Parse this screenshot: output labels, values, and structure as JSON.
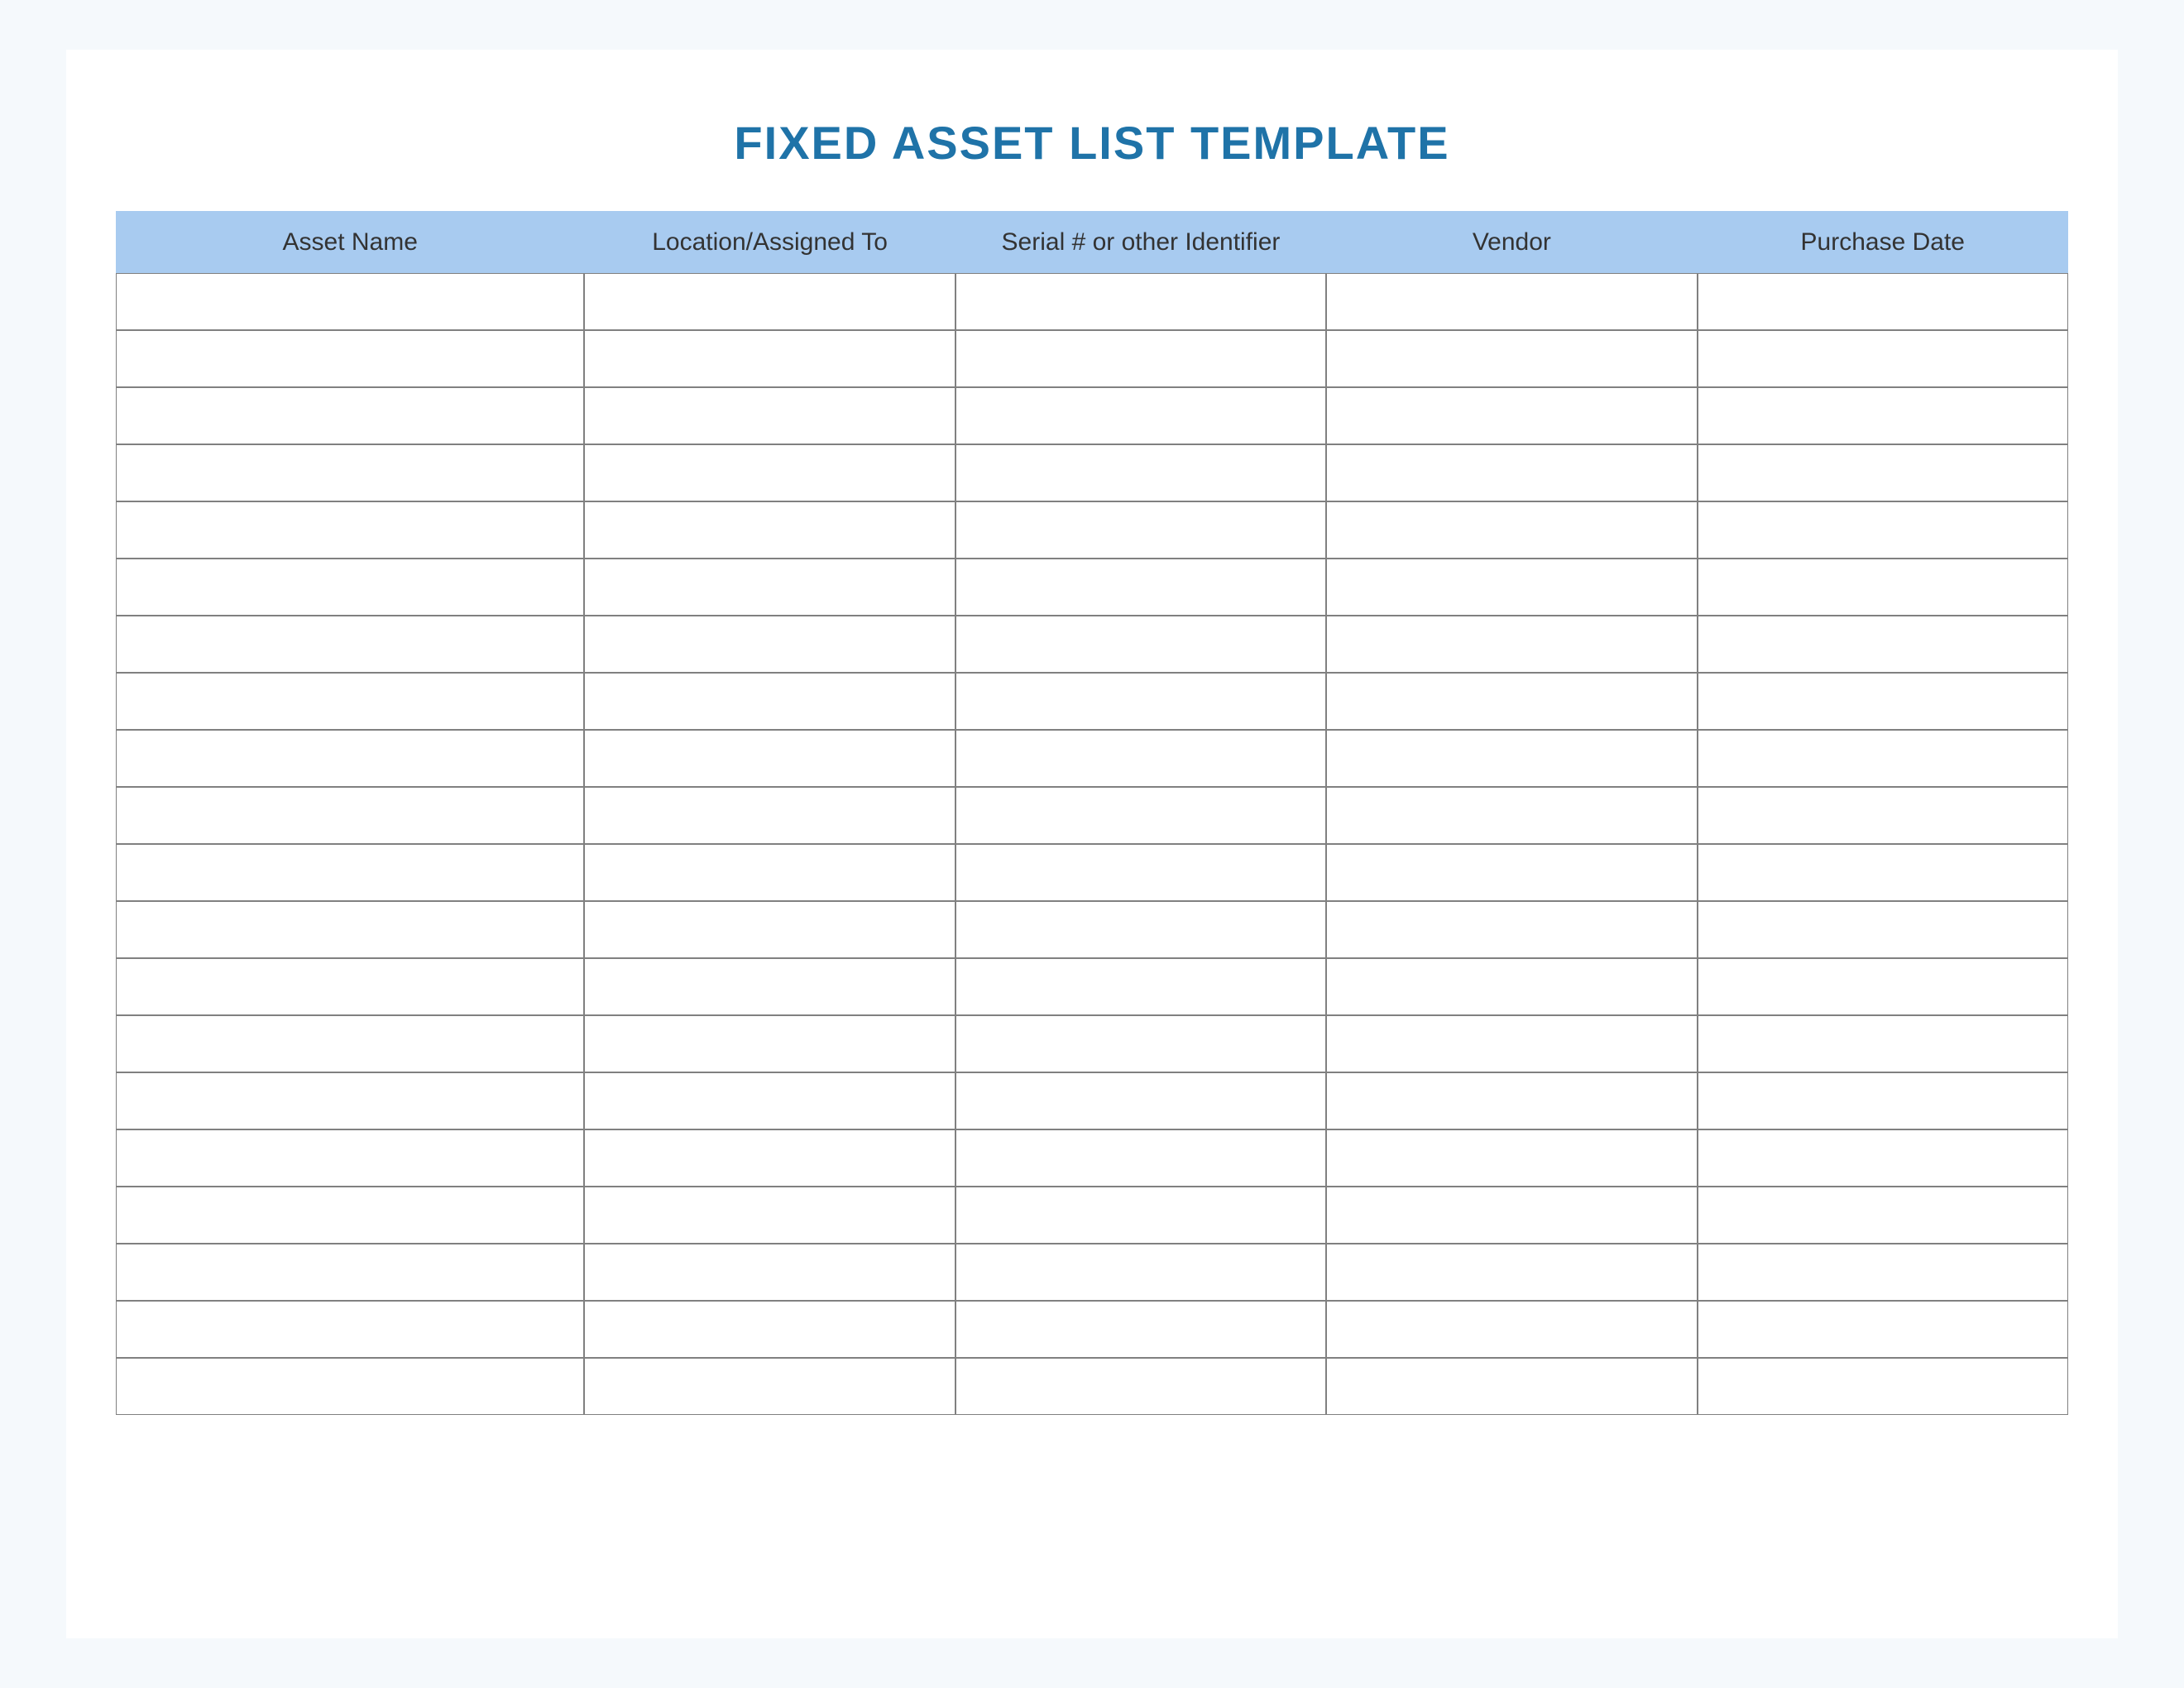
{
  "title": "FIXED ASSET LIST TEMPLATE",
  "colors": {
    "title": "#1f73a8",
    "header_bg": "#a8cbf0",
    "border": "#808080",
    "page_bg": "#f5f9fc"
  },
  "table": {
    "headers": [
      "Asset Name",
      "Location/Assigned To",
      "Serial # or other Identifier",
      "Vendor",
      "Purchase Date"
    ],
    "rows": [
      {
        "asset_name": "",
        "location": "",
        "serial": "",
        "vendor": "",
        "purchase_date": ""
      },
      {
        "asset_name": "",
        "location": "",
        "serial": "",
        "vendor": "",
        "purchase_date": ""
      },
      {
        "asset_name": "",
        "location": "",
        "serial": "",
        "vendor": "",
        "purchase_date": ""
      },
      {
        "asset_name": "",
        "location": "",
        "serial": "",
        "vendor": "",
        "purchase_date": ""
      },
      {
        "asset_name": "",
        "location": "",
        "serial": "",
        "vendor": "",
        "purchase_date": ""
      },
      {
        "asset_name": "",
        "location": "",
        "serial": "",
        "vendor": "",
        "purchase_date": ""
      },
      {
        "asset_name": "",
        "location": "",
        "serial": "",
        "vendor": "",
        "purchase_date": ""
      },
      {
        "asset_name": "",
        "location": "",
        "serial": "",
        "vendor": "",
        "purchase_date": ""
      },
      {
        "asset_name": "",
        "location": "",
        "serial": "",
        "vendor": "",
        "purchase_date": ""
      },
      {
        "asset_name": "",
        "location": "",
        "serial": "",
        "vendor": "",
        "purchase_date": ""
      },
      {
        "asset_name": "",
        "location": "",
        "serial": "",
        "vendor": "",
        "purchase_date": ""
      },
      {
        "asset_name": "",
        "location": "",
        "serial": "",
        "vendor": "",
        "purchase_date": ""
      },
      {
        "asset_name": "",
        "location": "",
        "serial": "",
        "vendor": "",
        "purchase_date": ""
      },
      {
        "asset_name": "",
        "location": "",
        "serial": "",
        "vendor": "",
        "purchase_date": ""
      },
      {
        "asset_name": "",
        "location": "",
        "serial": "",
        "vendor": "",
        "purchase_date": ""
      },
      {
        "asset_name": "",
        "location": "",
        "serial": "",
        "vendor": "",
        "purchase_date": ""
      },
      {
        "asset_name": "",
        "location": "",
        "serial": "",
        "vendor": "",
        "purchase_date": ""
      },
      {
        "asset_name": "",
        "location": "",
        "serial": "",
        "vendor": "",
        "purchase_date": ""
      },
      {
        "asset_name": "",
        "location": "",
        "serial": "",
        "vendor": "",
        "purchase_date": ""
      },
      {
        "asset_name": "",
        "location": "",
        "serial": "",
        "vendor": "",
        "purchase_date": ""
      }
    ]
  }
}
